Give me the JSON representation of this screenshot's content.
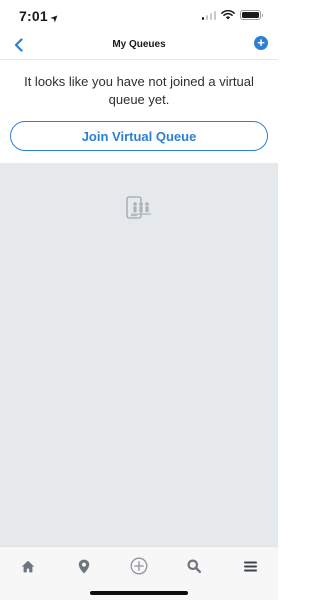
{
  "status_bar": {
    "time": "7:01",
    "icons": [
      "location-arrow-icon",
      "cellular-signal-icon",
      "wifi-icon",
      "battery-icon"
    ]
  },
  "header": {
    "title": "My Queues",
    "back_icon": "chevron-left-icon",
    "add_icon": "plus-circle-icon",
    "add_symbol": "+"
  },
  "main": {
    "empty_message": "It looks like you have not joined a virtual queue yet.",
    "join_button_label": "Join Virtual Queue",
    "illustration_icon": "virtual-queue-icon"
  },
  "tab_bar": {
    "items": [
      {
        "icon": "home-icon"
      },
      {
        "icon": "map-pin-icon"
      },
      {
        "icon": "plus-circle-icon"
      },
      {
        "icon": "search-icon"
      },
      {
        "icon": "menu-icon"
      }
    ]
  },
  "colors": {
    "accent": "#2d7fd6",
    "background_gray": "#e6e9ec",
    "tab_icon": "#6f757c"
  }
}
